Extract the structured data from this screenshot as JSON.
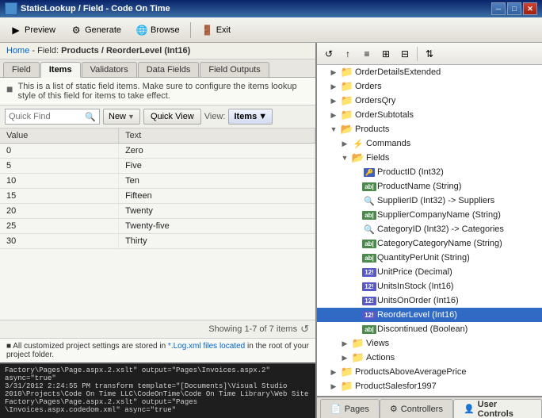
{
  "titleBar": {
    "title": "StaticLookup / Field - Code On Time",
    "appName": "Code On Time",
    "minBtn": "─",
    "maxBtn": "□",
    "closeBtn": "✕"
  },
  "toolbar": {
    "previewBtn": "Preview",
    "generateBtn": "Generate",
    "browseBtn": "Browse",
    "exitBtn": "Exit"
  },
  "breadcrumb": {
    "home": "Home",
    "separator": " > ",
    "field": "Field:",
    "path": "Products / ReorderLevel (Int16)"
  },
  "tabs": {
    "items": [
      "Field",
      "Items",
      "Validators",
      "Data Fields",
      "Field Outputs"
    ],
    "activeIndex": 1
  },
  "infoBar": {
    "text": "This is a list of static field items. Make sure to configure the items lookup style of this field for items to take effect."
  },
  "listToolbar": {
    "searchPlaceholder": "Quick Find",
    "newBtn": "New",
    "quickViewBtn": "Quick View",
    "viewLabel": "View:",
    "viewValue": "Items"
  },
  "table": {
    "columns": [
      "Value",
      "Text"
    ],
    "rows": [
      {
        "value": "0",
        "text": "Zero"
      },
      {
        "value": "5",
        "text": "Five"
      },
      {
        "value": "10",
        "text": "Ten"
      },
      {
        "value": "15",
        "text": "Fifteen"
      },
      {
        "value": "20",
        "text": "Twenty"
      },
      {
        "value": "25",
        "text": "Twenty-five"
      },
      {
        "value": "30",
        "text": "Thirty"
      }
    ],
    "footerText": "Showing 1-7 of 7 items"
  },
  "logArea": {
    "text": "■ All customized project settings are stored in ",
    "linkText": "*.Log.xml files located",
    "suffix": " in the root of your project folder."
  },
  "console": {
    "lines": [
      "Factory\\Pages\\Page.aspx.2.xslt\" output=\"Pages\\Invoices.aspx.2\" async=\"true\"",
      "3/31/2012 2:24:55 PM transform template=\"[Documents]\\Visual Studio",
      "2010\\Projects\\Code On Time LLC\\CodeOnTime\\Code On Time Library\\Web Site",
      "Factory\\Pages\\Page.aspx.2.xslt\" output=\"Pages",
      "\\Invoices.aspx.codedom.xml\" async=\"true\""
    ]
  },
  "rightPanel": {
    "toolbar": {
      "icons": [
        "↺",
        "↑",
        "≡",
        "⊞",
        "⊟",
        "⇅"
      ]
    },
    "tree": [
      {
        "indent": 1,
        "icon": "folder",
        "label": "OrderDetailsExtended",
        "arrow": "▶",
        "id": "orderDetailsExtended"
      },
      {
        "indent": 1,
        "icon": "folder",
        "label": "Orders",
        "arrow": "▶",
        "id": "orders"
      },
      {
        "indent": 1,
        "icon": "folder",
        "label": "OrdersQry",
        "arrow": "▶",
        "id": "ordersQry"
      },
      {
        "indent": 1,
        "icon": "folder",
        "label": "OrderSubtotals",
        "arrow": "▶",
        "id": "orderSubtotals"
      },
      {
        "indent": 1,
        "icon": "folder-open",
        "label": "Products",
        "arrow": "▼",
        "id": "products"
      },
      {
        "indent": 2,
        "icon": "cmd",
        "label": "Commands",
        "arrow": "▶",
        "id": "commands"
      },
      {
        "indent": 2,
        "icon": "folder-open",
        "label": "Fields",
        "arrow": "▼",
        "id": "fields"
      },
      {
        "indent": 3,
        "icon": "key",
        "label": "ProductID (Int32)",
        "arrow": "",
        "id": "productId"
      },
      {
        "indent": 3,
        "icon": "str",
        "label": "ProductName (String)",
        "arrow": "",
        "id": "productName"
      },
      {
        "indent": 3,
        "icon": "search",
        "label": "SupplierID (Int32) -> Suppliers",
        "arrow": "",
        "id": "supplierId"
      },
      {
        "indent": 3,
        "icon": "str",
        "label": "SupplierCompanyName (String)",
        "arrow": "",
        "id": "supplierCompanyName"
      },
      {
        "indent": 3,
        "icon": "search",
        "label": "CategoryID (Int32) -> Categories",
        "arrow": "",
        "id": "categoryId"
      },
      {
        "indent": 3,
        "icon": "str",
        "label": "CategoryCategoryName (String)",
        "arrow": "",
        "id": "categoryCategoryName"
      },
      {
        "indent": 3,
        "icon": "str",
        "label": "QuantityPerUnit (String)",
        "arrow": "",
        "id": "quantityPerUnit"
      },
      {
        "indent": 3,
        "icon": "int",
        "label": "UnitPrice (Decimal)",
        "arrow": "",
        "id": "unitPrice"
      },
      {
        "indent": 3,
        "icon": "int",
        "label": "UnitsInStock (Int16)",
        "arrow": "",
        "id": "unitsInStock"
      },
      {
        "indent": 3,
        "icon": "int",
        "label": "UnitsOnOrder (Int16)",
        "arrow": "",
        "id": "unitsOnOrder"
      },
      {
        "indent": 3,
        "icon": "int-selected",
        "label": "ReorderLevel (Int16)",
        "arrow": "",
        "id": "reorderLevel",
        "selected": true
      },
      {
        "indent": 3,
        "icon": "str",
        "label": "Discontinued (Boolean)",
        "arrow": "",
        "id": "discontinued"
      },
      {
        "indent": 2,
        "icon": "folder",
        "label": "Views",
        "arrow": "▶",
        "id": "views"
      },
      {
        "indent": 2,
        "icon": "folder",
        "label": "Actions",
        "arrow": "▶",
        "id": "actions"
      },
      {
        "indent": 1,
        "icon": "folder",
        "label": "ProductsAboveAveragePrice",
        "arrow": "▶",
        "id": "productsAboveAveragePrice"
      },
      {
        "indent": 1,
        "icon": "folder",
        "label": "ProductSalesfor1997",
        "arrow": "▶",
        "id": "productSalesfor1997"
      }
    ],
    "bottomTabs": [
      {
        "icon": "📄",
        "label": "Pages",
        "active": false
      },
      {
        "icon": "⚙",
        "label": "Controllers",
        "active": false
      },
      {
        "icon": "👤",
        "label": "User Controls",
        "active": false
      }
    ]
  }
}
